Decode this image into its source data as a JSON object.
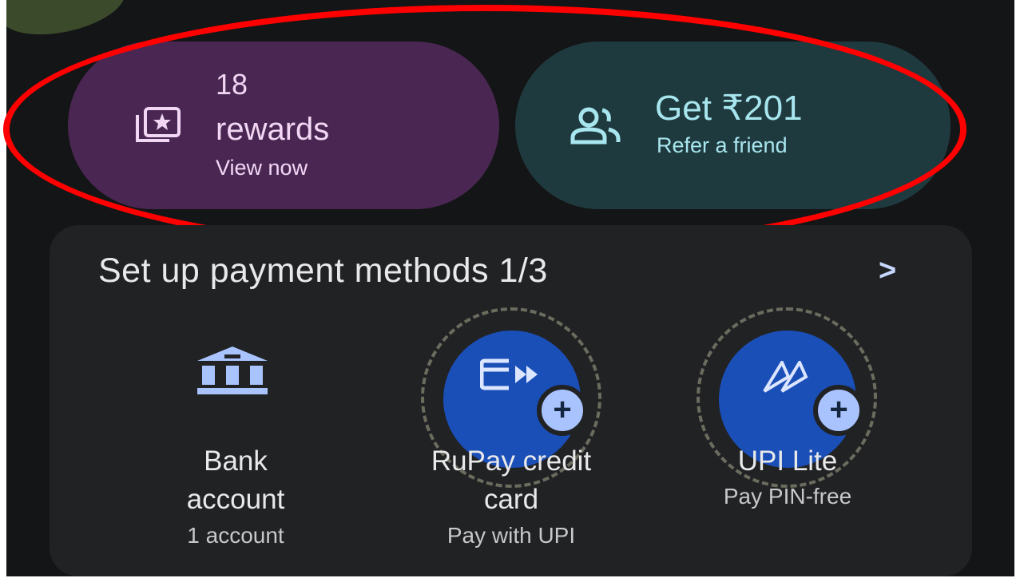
{
  "rewards": {
    "count": "18",
    "label": "rewards",
    "cta": "View now"
  },
  "referral": {
    "title": "Get ₹201",
    "subtitle": "Refer a friend"
  },
  "payment_setup": {
    "title": "Set up payment methods 1/3",
    "methods": [
      {
        "name_line1": "Bank",
        "name_line2": "account",
        "subtitle": "1 account",
        "icon": "bank-icon"
      },
      {
        "name_line1": "RuPay credit",
        "name_line2": "card",
        "subtitle": "Pay with UPI",
        "icon": "credit-card-icon"
      },
      {
        "name_line1": "UPI Lite",
        "name_line2": "",
        "subtitle": "Pay PIN-free",
        "icon": "upi-lite-icon"
      }
    ]
  },
  "colors": {
    "background": "#141516",
    "rewards_pill": "#4a2752",
    "referral_pill": "#1f3a3f",
    "card": "#212224",
    "accent_blue": "#1a4fb8",
    "annotation": "#ff0000"
  }
}
